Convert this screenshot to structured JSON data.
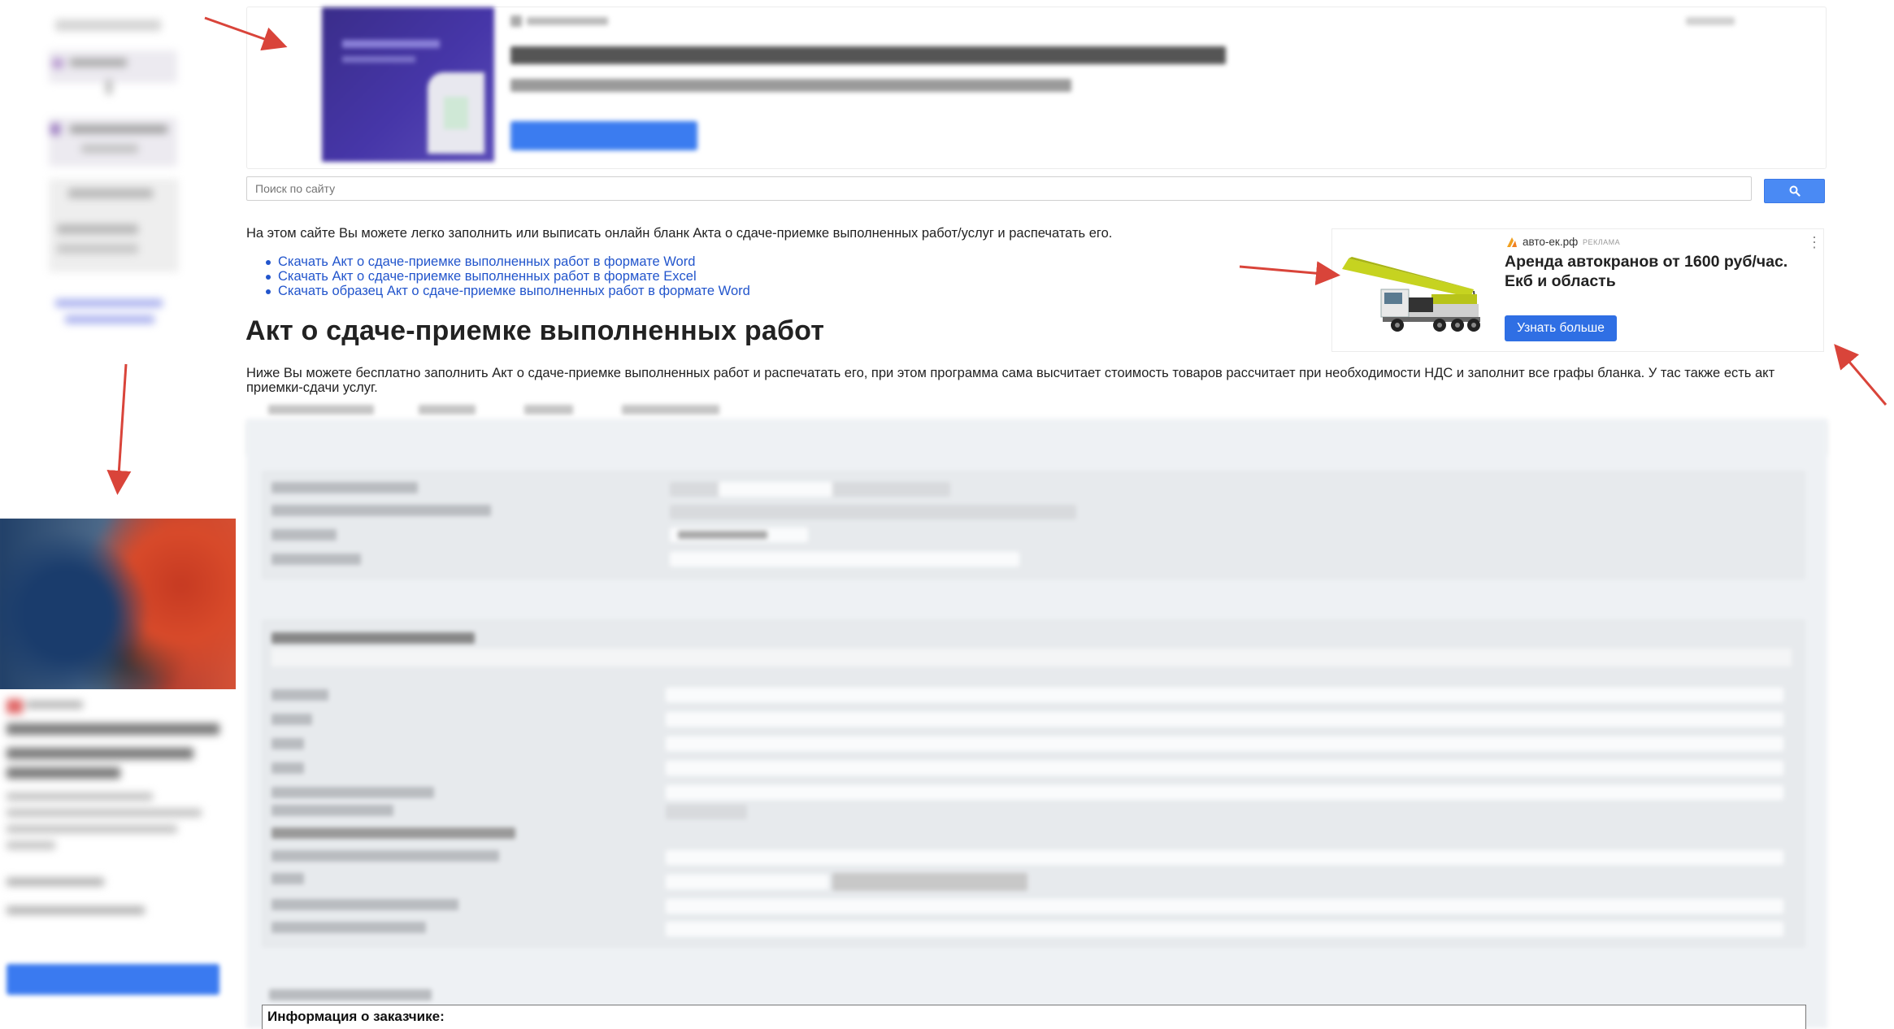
{
  "search": {
    "placeholder": "Поиск по сайту",
    "button_icon": "search-icon"
  },
  "intro_text": "На этом сайте Вы можете легко заполнить или выписать онлайн бланк Акта о сдаче-приемке выполненных работ/услуг и распечатать его.",
  "download_links": [
    "Скачать Акт о сдаче-приемке выполненных работ в формате Word",
    "Скачать Акт о сдаче-приемке выполненных работ в формате Excel",
    "Скачать образец Акт о сдаче-приемке выполненных работ в формате Word"
  ],
  "page_title": "Акт о сдаче-приемке выполненных работ",
  "description": "Ниже Вы можете бесплатно заполнить Акт о сдаче-приемке выполненных работ и распечатать его, при этом программа сама высчитает стоимость товаров рассчитает при необходимости НДС и заполнит все графы бланка. У тас также есть акт приемки-сдачи услуг.",
  "right_ad": {
    "domain": "авто-ек.рф",
    "tag": "РЕКЛАМА",
    "headline": "Аренда автокранов от 1600 руб/час. Екб и область",
    "cta": "Узнать больше",
    "menu_icon": "more-vertical-icon"
  },
  "form": {
    "customer_info_header": "Информация о заказчике:"
  },
  "colors": {
    "link": "#2255cc",
    "search_button": "#4a8af4",
    "ad_cta": "#2f6fe4",
    "annotation_arrow": "#d9443a",
    "top_ad_image": "#3a2d8a"
  }
}
